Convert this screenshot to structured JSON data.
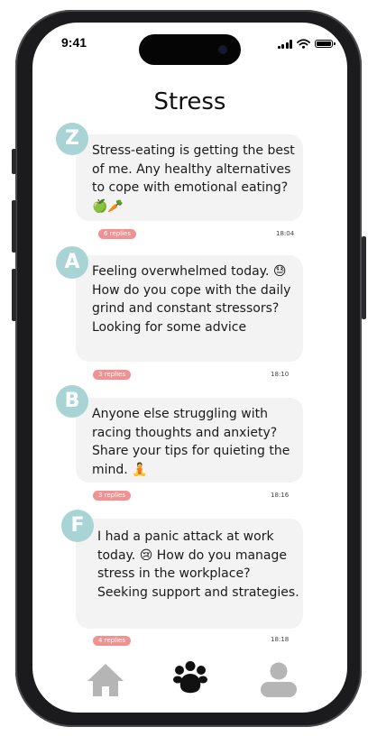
{
  "status_bar": {
    "time": "9:41"
  },
  "page_title": "Stress",
  "posts": [
    {
      "avatar": "Z",
      "text": "Stress-eating is getting the best of me. Any healthy alternatives to cope with emotional eating? 🍏🥕",
      "replies": "6 replies",
      "time": "18:04"
    },
    {
      "avatar": "A",
      "text": "Feeling overwhelmed today. 😓 How do you cope with the daily grind and constant stressors? Looking for some advice",
      "replies": "3 replies",
      "time": "18:10"
    },
    {
      "avatar": "B",
      "text": "Anyone else struggling with racing thoughts and anxiety? Share your tips for quieting the mind. 🧘",
      "replies": "3 replies",
      "time": "18:16"
    },
    {
      "avatar": "F",
      "text": "I had a panic attack at work today. 😢 How do you manage stress in the workplace? Seeking support and strategies.",
      "replies": "4 replies",
      "time": "18:18"
    }
  ],
  "nav": {
    "items": [
      {
        "icon": "home-icon",
        "active": false
      },
      {
        "icon": "community-paw-icon",
        "active": true
      },
      {
        "icon": "profile-icon",
        "active": false
      }
    ]
  },
  "colors": {
    "avatar_bg": "#a8d4d5",
    "replies_badge": "#f29191",
    "card_bg": "#f3f3f3",
    "nav_active": "#111111",
    "nav_inactive": "#b5b5b5"
  }
}
